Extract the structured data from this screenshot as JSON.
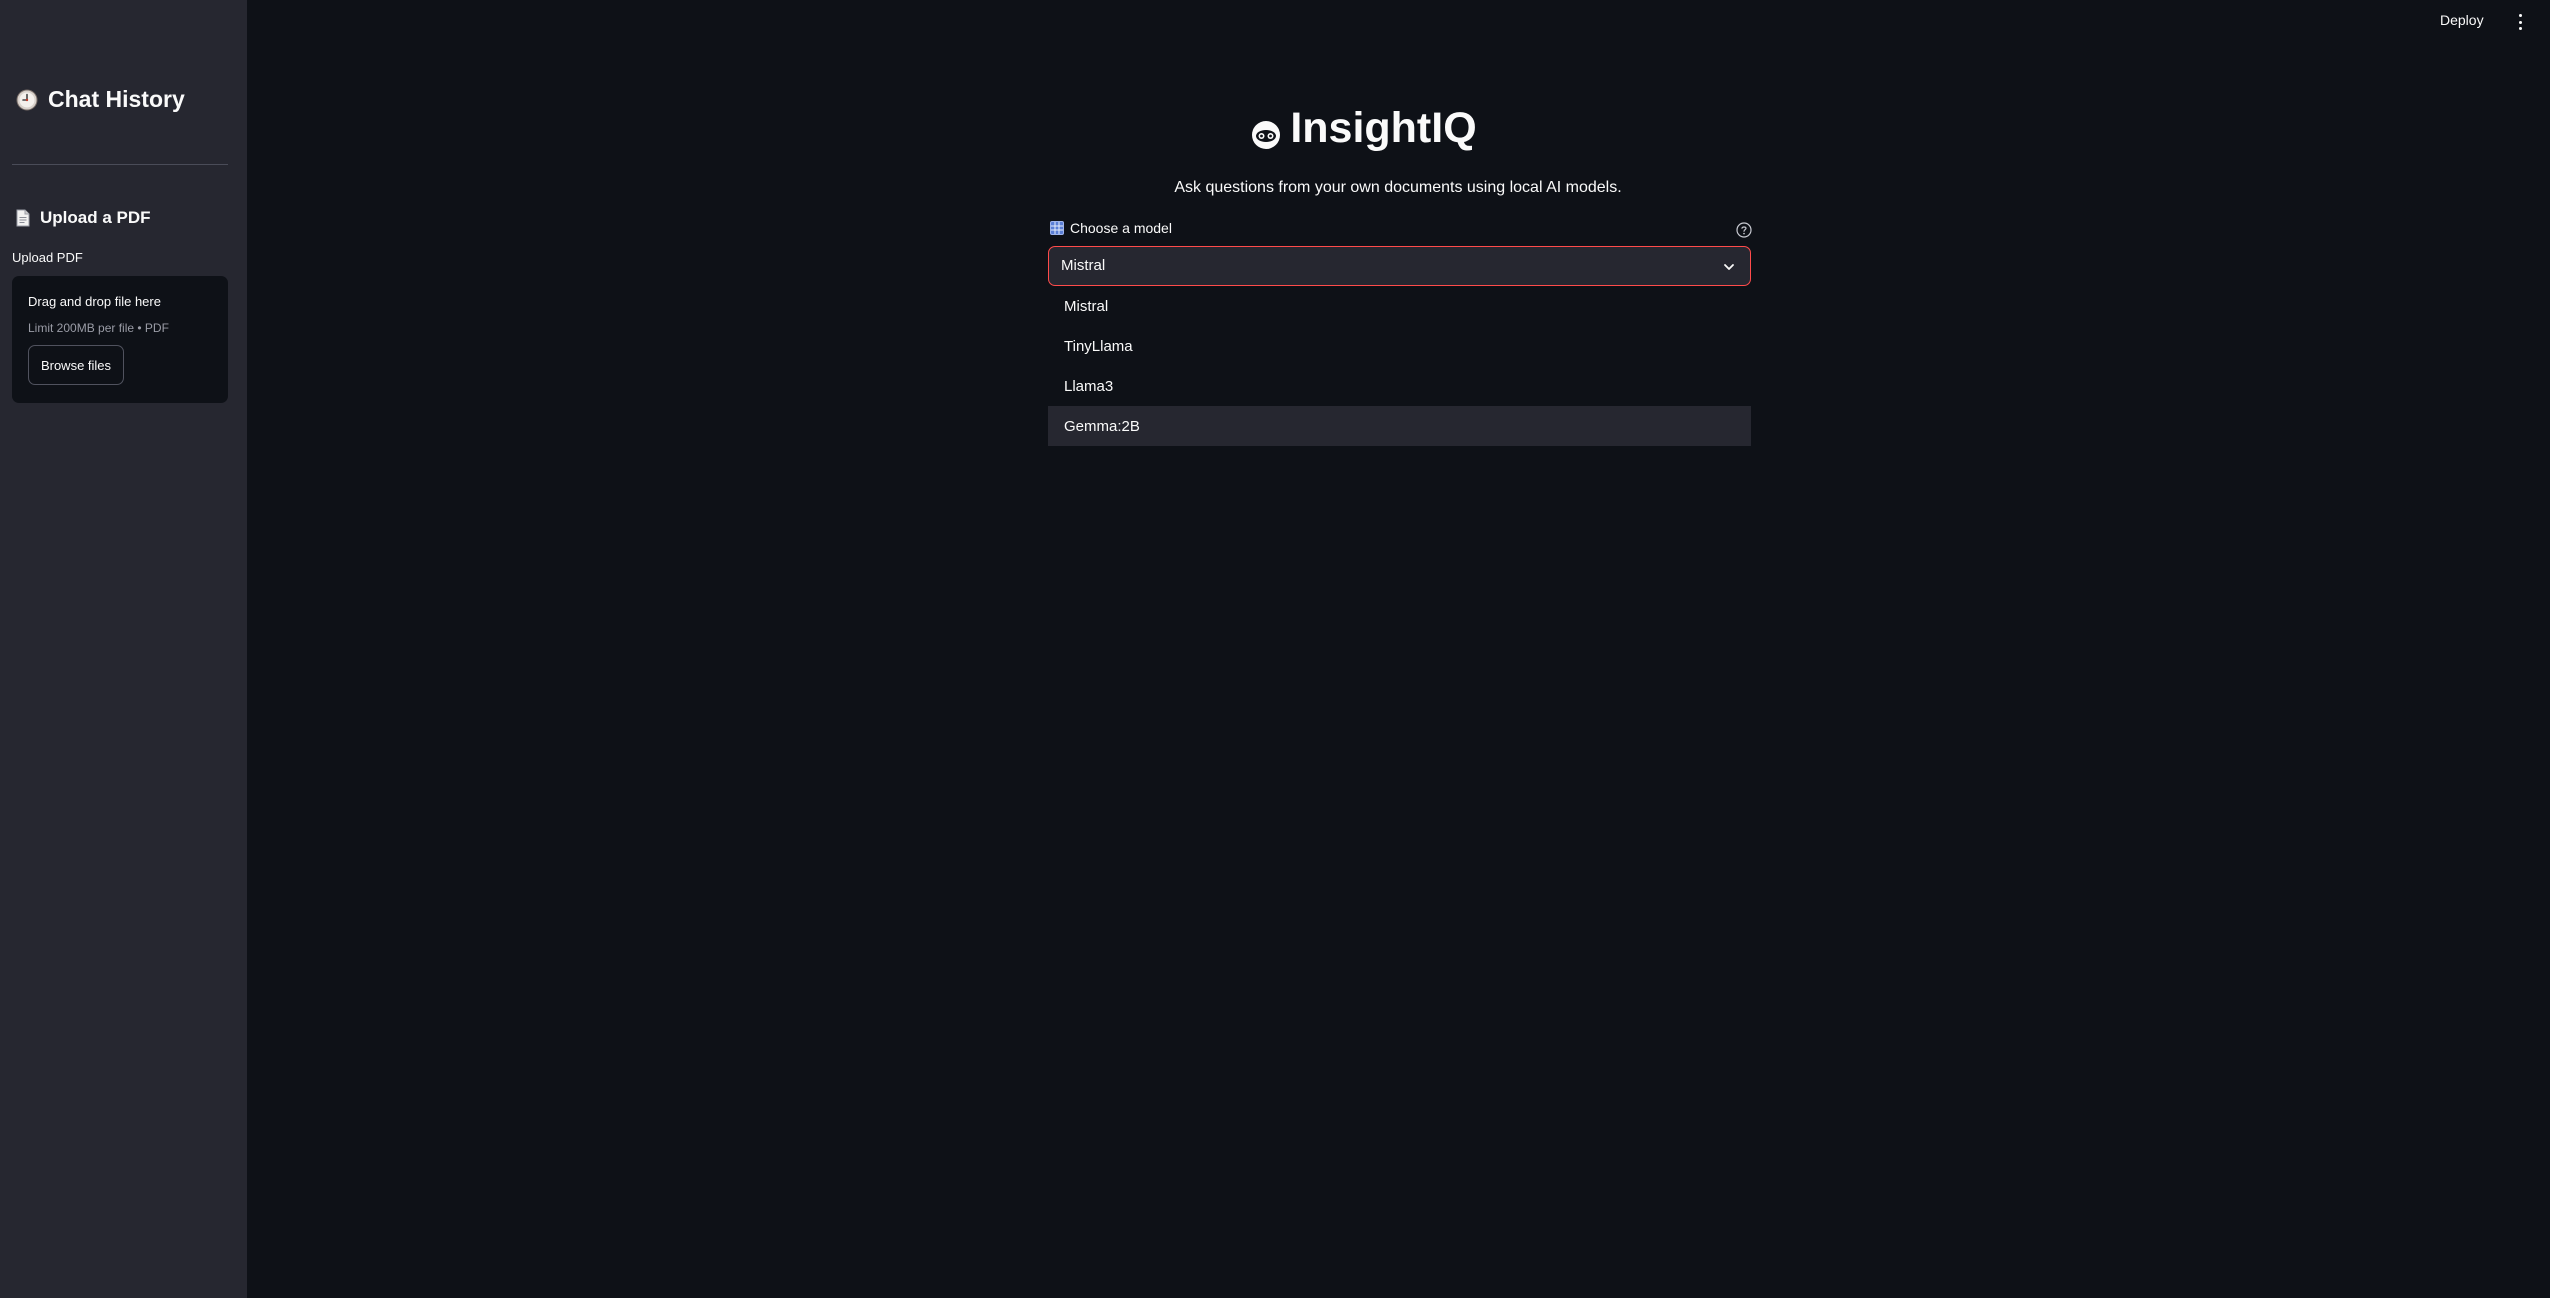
{
  "sidebar": {
    "title": "Chat History",
    "title_icon": "clock-icon",
    "upload_section_title": "Upload a PDF",
    "upload_section_icon": "document-icon",
    "upload_label": "Upload PDF",
    "dropzone": {
      "main_text": "Drag and drop file here",
      "limit_text": "Limit 200MB per file • PDF",
      "browse_label": "Browse files"
    }
  },
  "toolbar": {
    "deploy_label": "Deploy",
    "menu_icon": "kebab-menu-icon"
  },
  "main": {
    "title": "InsightIQ",
    "title_icon": "face-icon",
    "subtitle": "Ask questions from your own documents using local AI models.",
    "model_select": {
      "label": "Choose a model",
      "label_icon": "grid-icon",
      "value": "Mistral",
      "options": [
        "Mistral",
        "TinyLlama",
        "Llama3",
        "Gemma:2B"
      ],
      "hovered_option": "Gemma:2B"
    }
  },
  "colors": {
    "background": "#0e1117",
    "sidebar": "#262730",
    "accent": "#ff4b4b",
    "text": "#fafafa"
  }
}
